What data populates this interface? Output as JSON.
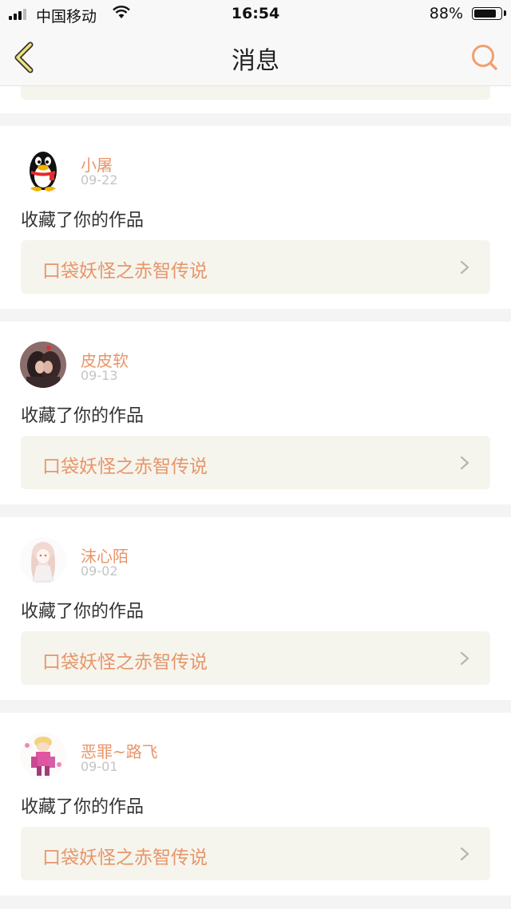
{
  "status_bar": {
    "carrier": "中国移动",
    "time": "16:54",
    "battery": "88%",
    "battery_level": 0.88
  },
  "nav": {
    "title": "消息",
    "back_icon": "chevron-left-icon",
    "search_icon": "search-icon"
  },
  "colors": {
    "accent": "#e8956a",
    "link_box_bg": "#f5f5ed",
    "date": "#c4c4c4"
  },
  "messages": [
    {
      "user": "小屠",
      "date": "09-22",
      "action": "收藏了你的作品",
      "work": "口袋妖怪之赤智传说"
    },
    {
      "user": "皮皮软",
      "date": "09-13",
      "action": "收藏了你的作品",
      "work": "口袋妖怪之赤智传说"
    },
    {
      "user": "沫心陌",
      "date": "09-02",
      "action": "收藏了你的作品",
      "work": "口袋妖怪之赤智传说"
    },
    {
      "user": "恶罪~路飞",
      "date": "09-01",
      "action": "收藏了你的作品",
      "work": "口袋妖怪之赤智传说"
    }
  ]
}
